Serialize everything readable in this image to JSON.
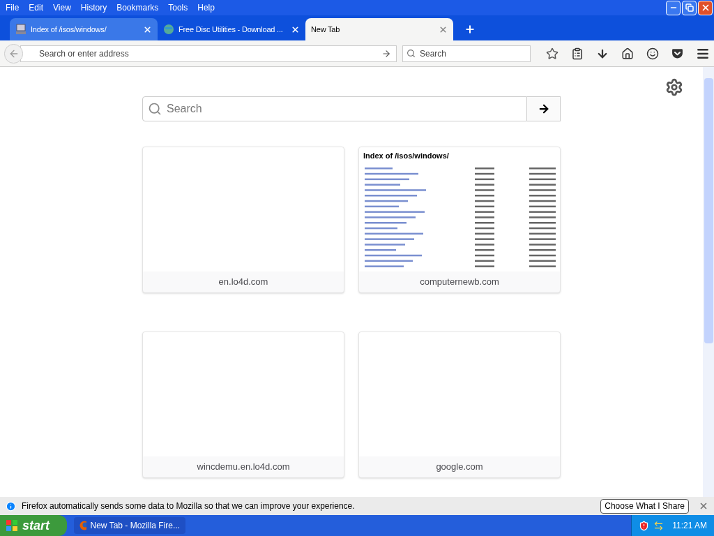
{
  "menu_bar": [
    "File",
    "Edit",
    "View",
    "History",
    "Bookmarks",
    "Tools",
    "Help"
  ],
  "tabs": [
    {
      "title": "Index of /isos/windows/",
      "selected": false,
      "kind": "page"
    },
    {
      "title": "Free Disc Utilities - Download ...",
      "selected": false,
      "kind": "globe"
    },
    {
      "title": "New Tab",
      "selected": true,
      "kind": "blank"
    }
  ],
  "address_bar": {
    "placeholder": "Search or enter address"
  },
  "search_box": {
    "placeholder": "Search"
  },
  "page_search": {
    "placeholder": "Search"
  },
  "top_sites": [
    {
      "label": "en.lo4d.com",
      "kind": "blank"
    },
    {
      "label": "computernewb.com",
      "kind": "listing",
      "thumbnail_title": "Index of /isos/windows/"
    },
    {
      "label": "wincdemu.en.lo4d.com",
      "kind": "blank"
    },
    {
      "label": "google.com",
      "kind": "blank"
    }
  ],
  "notification": {
    "message": "Firefox automatically sends some data to Mozilla so that we can improve your experience.",
    "button": "Choose What I Share"
  },
  "taskbar": {
    "start": "start",
    "task": "New Tab - Mozilla Fire...",
    "clock": "11:21 AM"
  }
}
